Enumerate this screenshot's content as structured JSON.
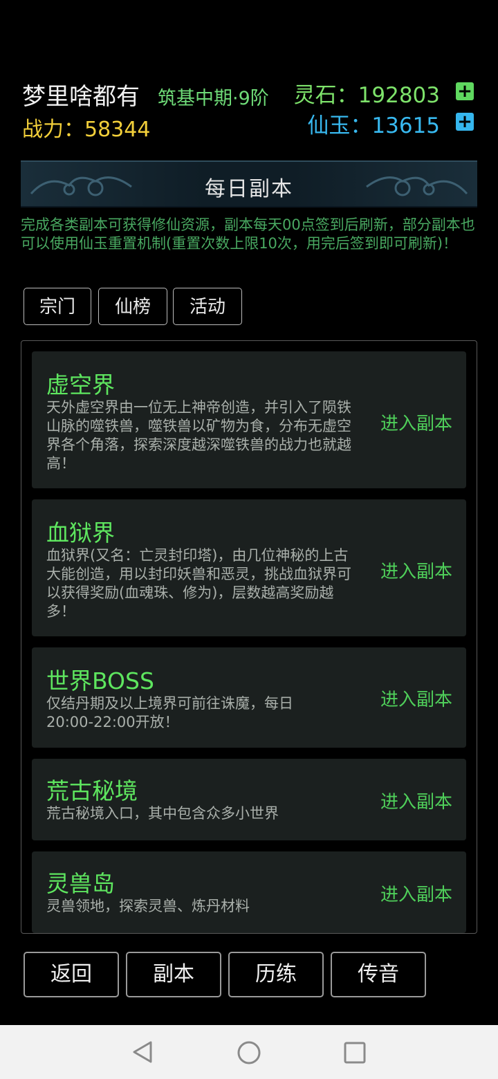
{
  "header": {
    "player_name": "梦里啥都有",
    "realm": "筑基中期·9阶",
    "power_label": "战力：",
    "power_value": "58344",
    "spirit_stone_label": "灵石：",
    "spirit_stone_value": "192803",
    "jade_label": "仙玉：",
    "jade_value": "13615",
    "plus_symbol": "+"
  },
  "banner": {
    "title": "每日副本"
  },
  "intro": "完成各类副本可获得修仙资源，副本每天00点签到后刷新，部分副本也可以使用仙玉重置机制(重置次数上限10次，用完后签到即可刷新)！",
  "tabs": [
    {
      "label": "宗门"
    },
    {
      "label": "仙榜"
    },
    {
      "label": "活动"
    }
  ],
  "dungeons": [
    {
      "title": "虚空界",
      "desc": "天外虚空界由一位无上神帝创造，并引入了陨铁山脉的噬铁兽，噬铁兽以矿物为食，分布无虚空界各个角落，探索深度越深噬铁兽的战力也就越高！",
      "action": "进入副本"
    },
    {
      "title": "血狱界",
      "desc": "血狱界(又名：亡灵封印塔)，由几位神秘的上古大能创造，用以封印妖兽和恶灵，挑战血狱界可以获得奖励(血魂珠、修为)，层数越高奖励越多！",
      "action": "进入副本"
    },
    {
      "title": "世界BOSS",
      "desc": "仅结丹期及以上境界可前往诛魔，每日20:00-22:00开放！",
      "action": "进入副本"
    },
    {
      "title": "荒古秘境",
      "desc": "荒古秘境入口，其中包含众多小世界",
      "action": "进入副本"
    },
    {
      "title": "灵兽岛",
      "desc": "灵兽领地，探索灵兽、炼丹材料",
      "action": "进入副本"
    }
  ],
  "bottom_nav": [
    {
      "label": "返回"
    },
    {
      "label": "副本"
    },
    {
      "label": "历练"
    },
    {
      "label": "传音"
    }
  ],
  "system_nav": {
    "icons": [
      "back-triangle-icon",
      "home-circle-icon",
      "recents-square-icon"
    ]
  }
}
